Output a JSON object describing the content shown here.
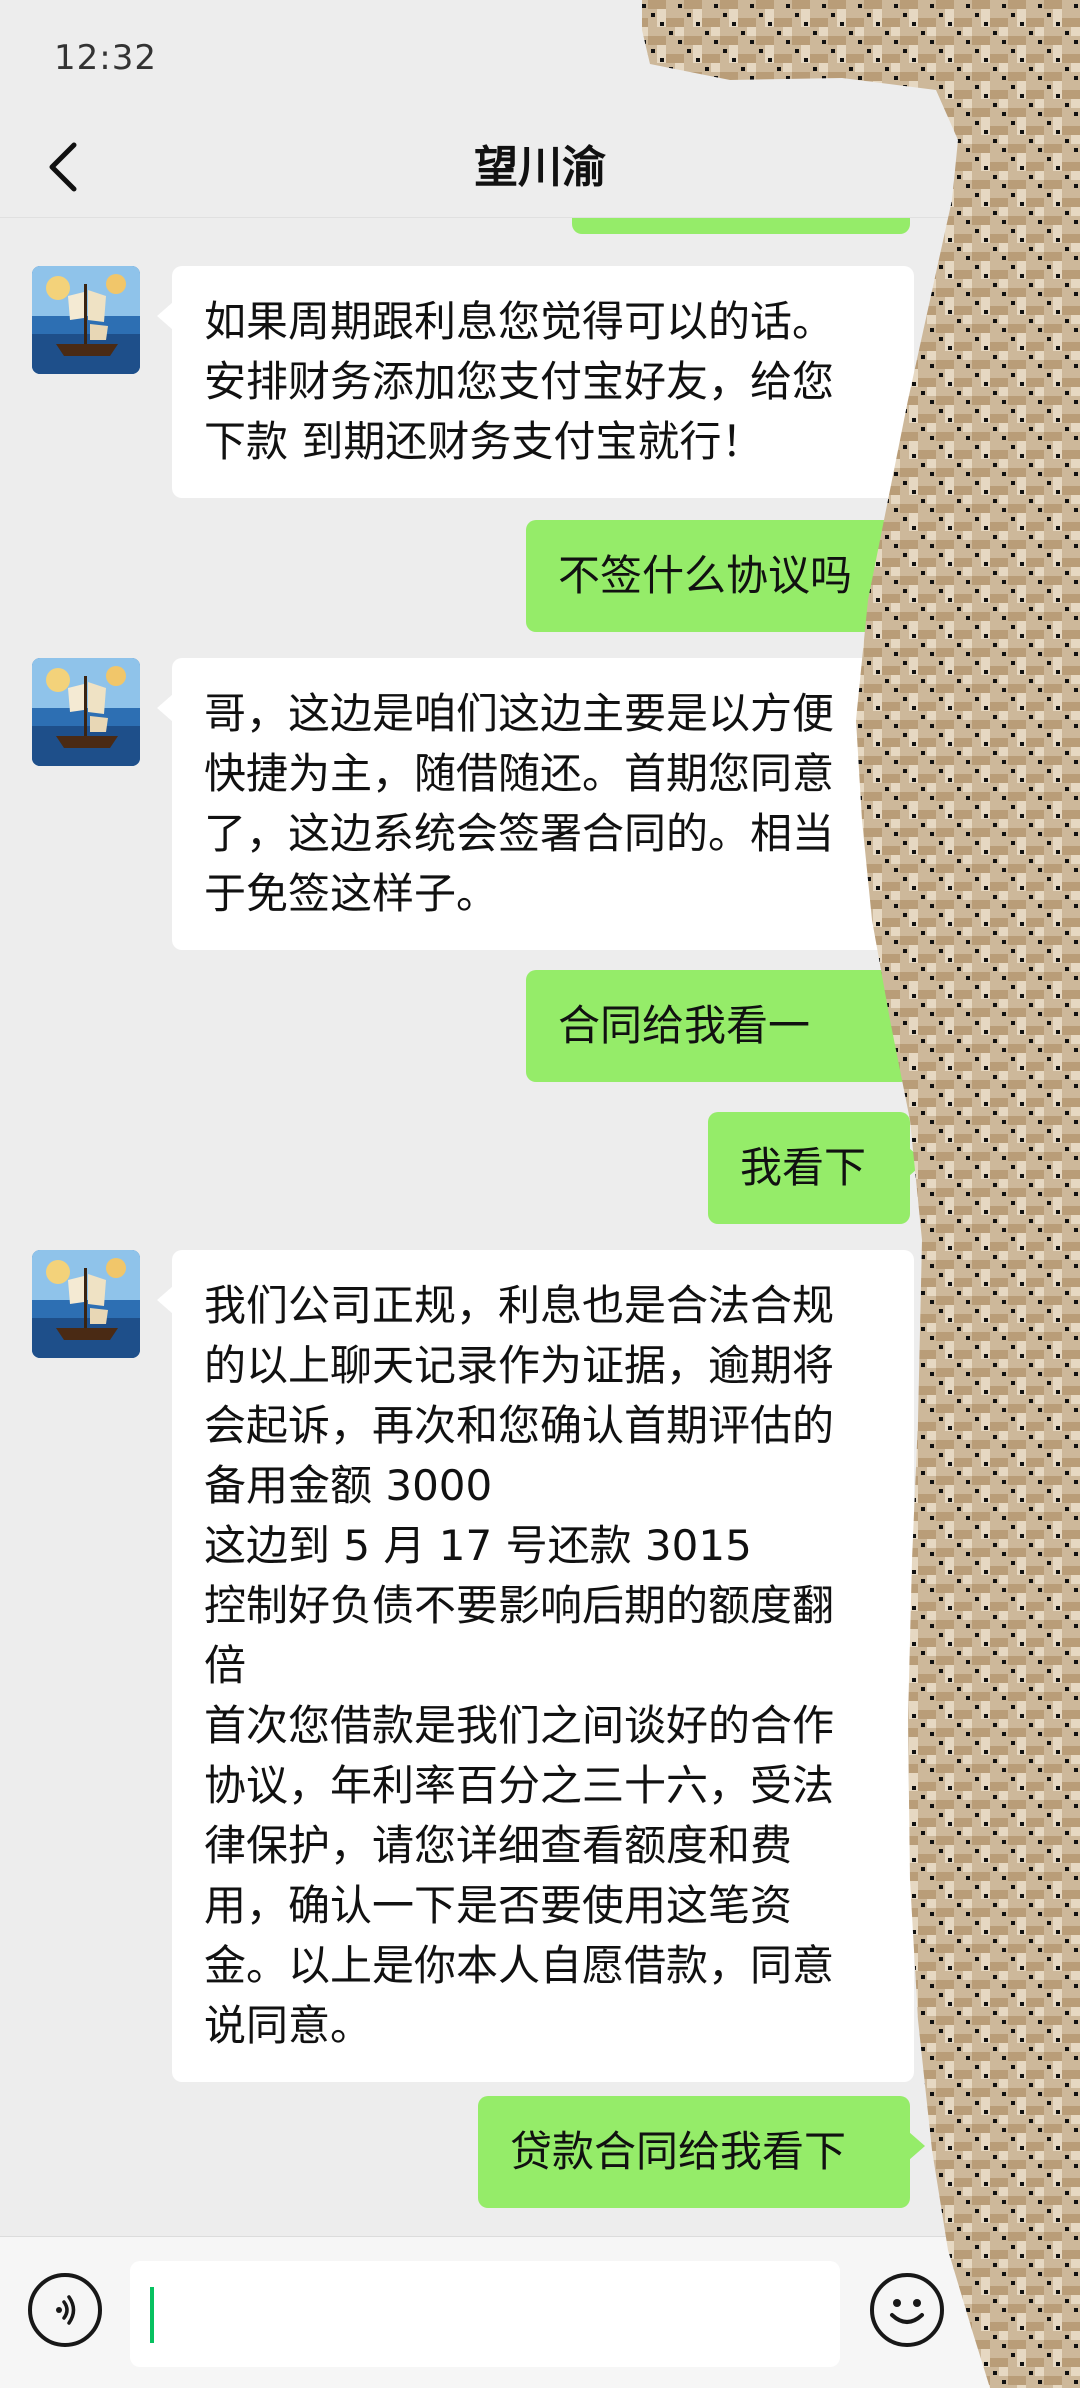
{
  "status_bar": {
    "time": "12:32"
  },
  "nav": {
    "title": "望川渝"
  },
  "messages": [
    {
      "from": "contact",
      "lines": [
        "如果周期跟利息您觉得可以的话。",
        "安排财务添加您支付宝好友，给您",
        "下款 到期还财务支付宝就行！"
      ]
    },
    {
      "from": "me",
      "lines": [
        "不签什么协议吗"
      ]
    },
    {
      "from": "contact",
      "lines": [
        "哥，这边是咱们这边主要是以方便",
        "快捷为主，随借随还。首期您同意",
        "了，这边系统会签署合同的。相当",
        "于免签这样子。"
      ]
    },
    {
      "from": "me",
      "lines": [
        "合同给我看一"
      ]
    },
    {
      "from": "me",
      "lines": [
        "我看下"
      ]
    },
    {
      "from": "contact",
      "lines": [
        "我们公司正规，利息也是合法合规",
        "的以上聊天记录作为证据，逾期将",
        "会起诉，再次和您确认首期评估的",
        "备用金额 3000",
        "这边到 5 月 17 号还款 3015",
        "控制好负债不要影响后期的额度翻",
        "倍",
        "首次您借款是我们之间谈好的合作",
        "协议，年利率百分之三十六，受法",
        "律保护，请您详细查看额度和费",
        "用，确认一下是否要使用这笔资",
        "金。以上是你本人自愿借款，同意",
        "说同意。"
      ]
    },
    {
      "from": "me",
      "lines": [
        "贷款合同给我看下"
      ]
    }
  ],
  "input_bar": {
    "value": ""
  },
  "colors": {
    "background": "#ededed",
    "outgoing_bubble": "#95ec69",
    "incoming_bubble": "#ffffff",
    "caret": "#07c160"
  },
  "icons": {
    "back": "chevron-left-icon",
    "voice": "voice-icon",
    "emoji": "emoji-icon",
    "more": "plus-icon",
    "avatar": "sailing-ship-avatar"
  }
}
